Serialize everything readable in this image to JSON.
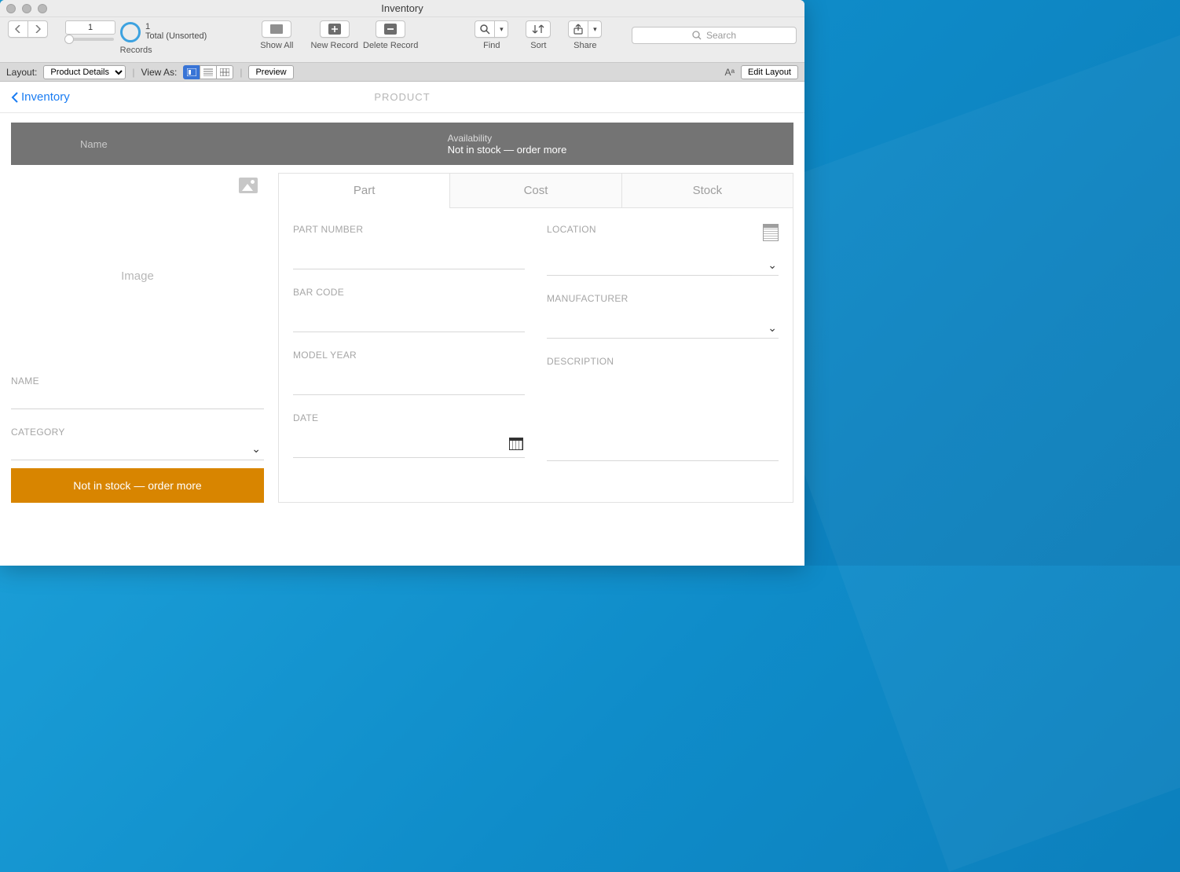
{
  "window": {
    "title": "Inventory"
  },
  "toolbar": {
    "records": {
      "value": "1",
      "total": "1",
      "sort_state": "Total (Unsorted)",
      "label": "Records"
    },
    "show_all": "Show All",
    "new_record": "New Record",
    "delete_record": "Delete Record",
    "find": "Find",
    "sort": "Sort",
    "share": "Share",
    "search_placeholder": "Search"
  },
  "layoutbar": {
    "layout_label": "Layout:",
    "layout_value": "Product Details",
    "view_as": "View As:",
    "preview": "Preview",
    "edit_layout": "Edit Layout",
    "aa": "Aᵃ"
  },
  "header": {
    "back": "Inventory",
    "center": "PRODUCT"
  },
  "band": {
    "name_label": "Name",
    "availability_label": "Availability",
    "availability_value": "Not in stock — order more"
  },
  "left": {
    "image_placeholder": "Image",
    "name_label": "NAME",
    "category_label": "CATEGORY",
    "stock_button": "Not in stock — order more"
  },
  "tabs": {
    "part": "Part",
    "cost": "Cost",
    "stock": "Stock"
  },
  "form": {
    "part_number": "PART NUMBER",
    "bar_code": "BAR CODE",
    "model_year": "MODEL YEAR",
    "date": "DATE",
    "location": "LOCATION",
    "manufacturer": "MANUFACTURER",
    "description": "DESCRIPTION"
  }
}
